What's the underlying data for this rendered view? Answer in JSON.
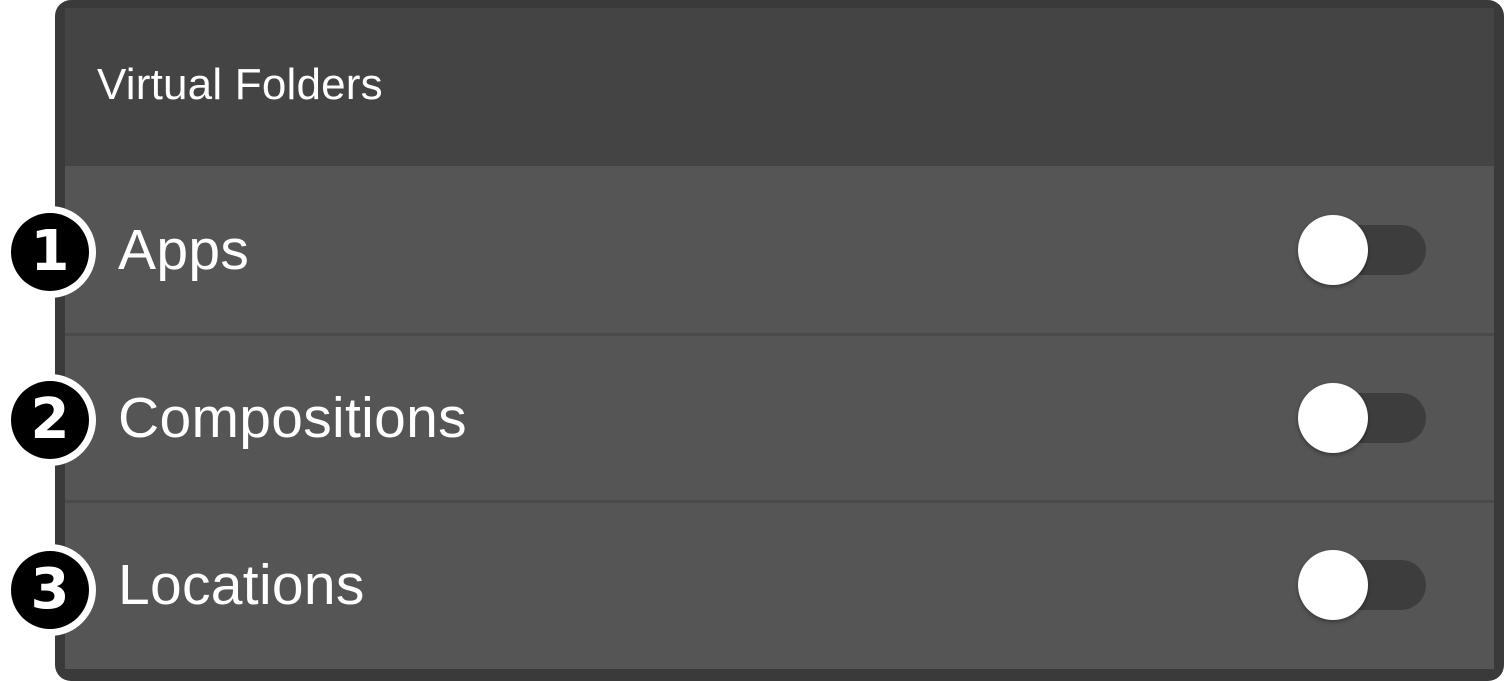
{
  "panel": {
    "title": "Virtual Folders"
  },
  "rows": [
    {
      "label": "Apps",
      "enabled": false,
      "callout": "1"
    },
    {
      "label": "Compositions",
      "enabled": false,
      "callout": "2"
    },
    {
      "label": "Locations",
      "enabled": false,
      "callout": "3"
    }
  ],
  "colors": {
    "panel_border": "#3a3a3a",
    "header_bg": "#444444",
    "row_bg": "#555555",
    "toggle_track": "#3d3d3d",
    "toggle_knob": "#ffffff",
    "callout_bg": "#000000"
  }
}
